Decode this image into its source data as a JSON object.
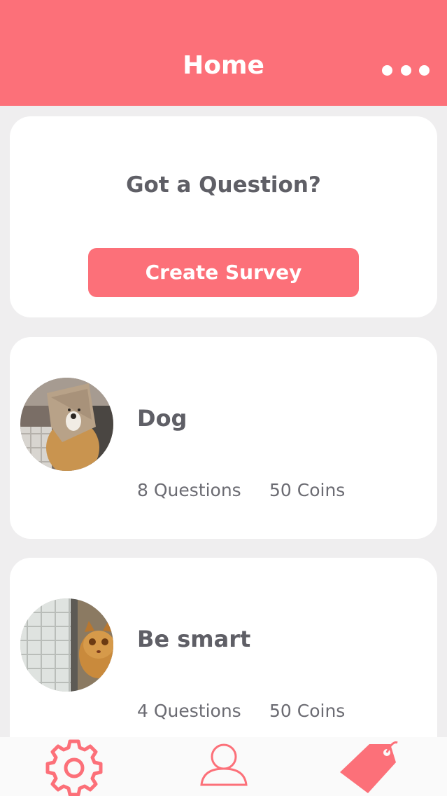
{
  "header": {
    "title": "Home",
    "more_icon": "ellipsis-icon"
  },
  "question_card": {
    "title": "Got a Question?",
    "button_label": "Create Survey"
  },
  "surveys": [
    {
      "title": "Dog",
      "questions": "8 Questions",
      "coins": "50 Coins",
      "avatar": "dog-photo"
    },
    {
      "title": "Be smart",
      "questions": "4 Questions",
      "coins": "50 Coins",
      "avatar": "cat-photo"
    }
  ],
  "tabbar": {
    "items": [
      {
        "icon": "gear-icon",
        "name": "settings"
      },
      {
        "icon": "person-icon",
        "name": "profile"
      },
      {
        "icon": "tag-icon",
        "name": "tags",
        "active": true
      }
    ]
  },
  "colors": {
    "accent": "#fc7079",
    "background": "#efeeef",
    "text": "#5f5f66"
  }
}
